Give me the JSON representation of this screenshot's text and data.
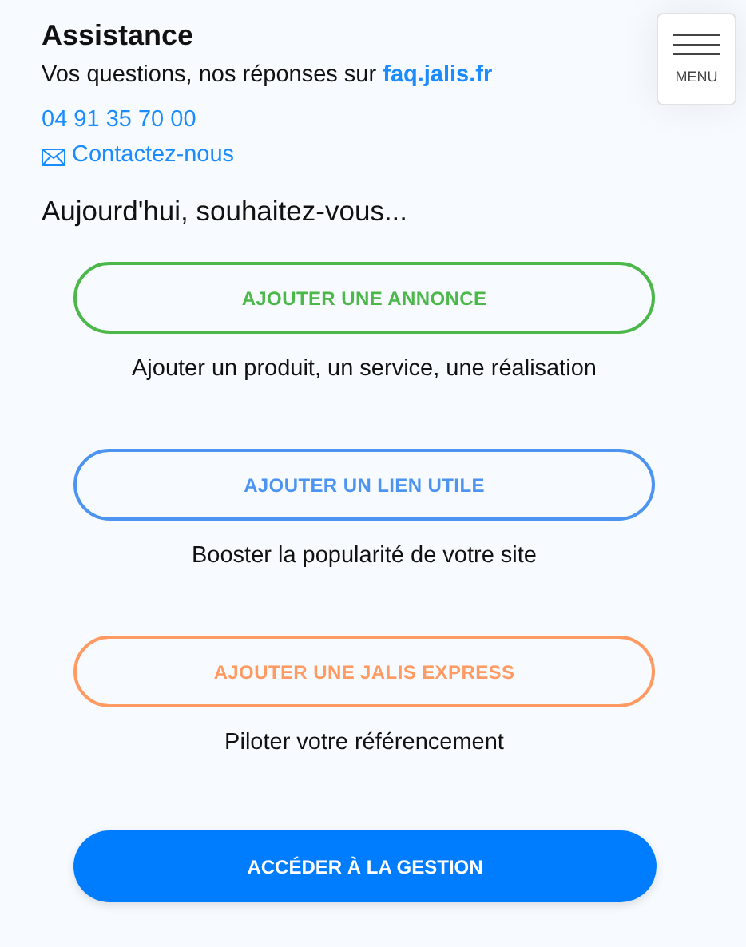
{
  "assistance": {
    "title": "Assistance",
    "intro_text": "Vos questions, nos réponses sur",
    "intro_link": "faq.jalis.fr",
    "phone": "04 91 35 70 00",
    "contact": "Contactez-nous"
  },
  "menu": {
    "label": "MENU"
  },
  "question": "Aujourd'hui, souhaitez-vous...",
  "actions": [
    {
      "label": "AJOUTER UNE ANNONCE",
      "color": "#4cb84a",
      "description": "Ajouter un produit, un service, une réalisation"
    },
    {
      "label": "AJOUTER UN LIEN UTILE",
      "color": "#4d94f0",
      "description": "Booster la popularité de votre site"
    },
    {
      "label": "AJOUTER UNE JALIS EXPRESS",
      "color": "#ff9a62",
      "description": "Piloter votre référencement"
    }
  ],
  "main_button": {
    "label": "ACCÉDER À LA GESTION"
  }
}
